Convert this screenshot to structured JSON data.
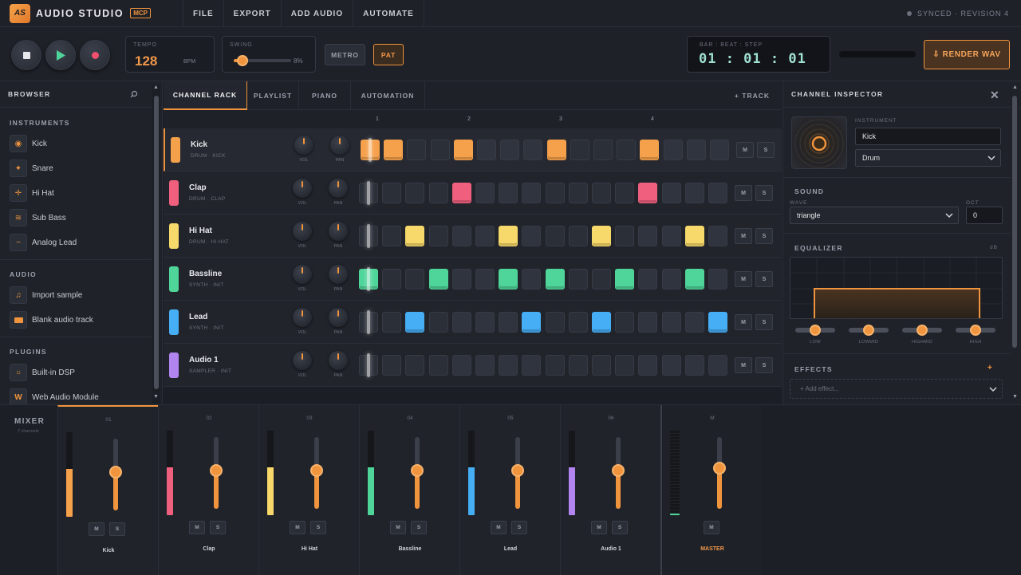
{
  "app": {
    "logo": "AS",
    "title": "AUDIO STUDIO",
    "badge": "MCP",
    "sync_status": "SYNCED · REVISION 4"
  },
  "menu": [
    "FILE",
    "EXPORT",
    "ADD AUDIO",
    "AUTOMATE"
  ],
  "transport": {
    "tempo_label": "TEMPO",
    "tempo": "128",
    "tempo_unit": "BPM",
    "swing_label": "SWING",
    "swing_value": "8%",
    "swing_level": 0.15,
    "metro": "METRO",
    "pat": "PAT",
    "clock_label": "BAR : BEAT : STEP",
    "clock": "01 : 01 : 01",
    "render": "⇩ RENDER WAV"
  },
  "browser": {
    "title": "BROWSER",
    "sections": [
      {
        "label": "INSTRUMENTS",
        "items": [
          {
            "label": "Kick",
            "icon": "target-icon"
          },
          {
            "label": "Snare",
            "icon": "sparkle-icon"
          },
          {
            "label": "Hi Hat",
            "icon": "crosshair-icon"
          },
          {
            "label": "Sub Bass",
            "icon": "wave-icon"
          },
          {
            "label": "Analog Lead",
            "icon": "tilde-icon"
          }
        ]
      },
      {
        "label": "AUDIO",
        "items": [
          {
            "label": "Import sample",
            "icon": "music-note-icon"
          },
          {
            "label": "Blank audio track",
            "icon": "clip-icon"
          }
        ]
      },
      {
        "label": "PLUGINS",
        "items": [
          {
            "label": "Built-in DSP",
            "icon": "circle-icon"
          },
          {
            "label": "Web Audio Module",
            "icon": "w-icon"
          }
        ]
      }
    ]
  },
  "tabs": [
    "CHANNEL RACK",
    "PLAYLIST",
    "PIANO",
    "AUTOMATION"
  ],
  "add_track": "+ TRACK",
  "ruler": [
    "1",
    "2",
    "3",
    "4"
  ],
  "knob_labels": {
    "vol": "VOL",
    "pan": "PAN"
  },
  "mute_label": "M",
  "solo_label": "S",
  "channels": [
    {
      "name": "Kick",
      "sub": "DRUM · KICK",
      "color": "#f5a04a",
      "steps": [
        1,
        1,
        0,
        0,
        1,
        0,
        0,
        0,
        1,
        0,
        0,
        0,
        1,
        0,
        0,
        0
      ]
    },
    {
      "name": "Clap",
      "sub": "DRUM · CLAP",
      "color": "#f0607e",
      "steps": [
        0,
        0,
        0,
        0,
        1,
        0,
        0,
        0,
        0,
        0,
        0,
        0,
        1,
        0,
        0,
        0
      ]
    },
    {
      "name": "Hi Hat",
      "sub": "DRUM · HI HAT",
      "color": "#f7d86a",
      "steps": [
        0,
        0,
        1,
        0,
        0,
        0,
        1,
        0,
        0,
        0,
        1,
        0,
        0,
        0,
        1,
        0
      ]
    },
    {
      "name": "Bassline",
      "sub": "SYNTH · INIT",
      "color": "#4fd59a",
      "steps": [
        1,
        0,
        0,
        1,
        0,
        0,
        1,
        0,
        1,
        0,
        0,
        1,
        0,
        0,
        1,
        0
      ]
    },
    {
      "name": "Lead",
      "sub": "SYNTH · INIT",
      "color": "#46aef5",
      "steps": [
        0,
        0,
        1,
        0,
        0,
        0,
        0,
        1,
        0,
        0,
        1,
        0,
        0,
        0,
        0,
        1
      ]
    },
    {
      "name": "Audio 1",
      "sub": "SAMPLER · INIT",
      "color": "#b284f0",
      "steps": [
        0,
        0,
        0,
        0,
        0,
        0,
        0,
        0,
        0,
        0,
        0,
        0,
        0,
        0,
        0,
        0
      ]
    }
  ],
  "inspector": {
    "title": "CHANNEL INSPECTOR",
    "instrument_label": "INSTRUMENT",
    "name": "Kick",
    "type": "Drum",
    "sound_label": "SOUND",
    "wave_label": "WAVE",
    "wave": "triangle",
    "oct_label": "OCT",
    "oct": "0",
    "eq_label": "EQUALIZER",
    "eq_unit": "dB",
    "eq_bands": [
      {
        "label": "LOW",
        "level": 0.5
      },
      {
        "label": "LOWMID",
        "level": 0.5
      },
      {
        "label": "HIGHMID",
        "level": 0.5
      },
      {
        "label": "HIGH",
        "level": 0.5
      }
    ],
    "effects_label": "EFFECTS",
    "effects_add": "+",
    "add_effect": "+ Add effect..."
  },
  "mixer": {
    "title": "MIXER",
    "sub": "7 channels",
    "strips": [
      {
        "num": "01",
        "name": "Kick",
        "color": "#f5a04a",
        "level": 0.57,
        "fader": 0.53
      },
      {
        "num": "02",
        "name": "Clap",
        "color": "#f0607e",
        "level": 0.57,
        "fader": 0.53
      },
      {
        "num": "03",
        "name": "Hi Hat",
        "color": "#f7d86a",
        "level": 0.57,
        "fader": 0.53
      },
      {
        "num": "04",
        "name": "Bassline",
        "color": "#4fd59a",
        "level": 0.57,
        "fader": 0.53
      },
      {
        "num": "05",
        "name": "Lead",
        "color": "#46aef5",
        "level": 0.57,
        "fader": 0.53
      },
      {
        "num": "06",
        "name": "Audio 1",
        "color": "#b284f0",
        "level": 0.57,
        "fader": 0.53
      }
    ],
    "master": {
      "num": "M",
      "name": "MASTER",
      "level": 0.02,
      "fader": 0.57
    }
  }
}
